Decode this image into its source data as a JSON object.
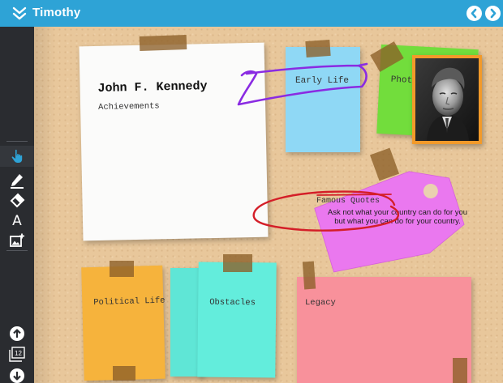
{
  "topbar": {
    "title": "Timothy",
    "bar_color": "#2ea3d6",
    "collapse_icon": "double-chevron-down",
    "prev_icon": "chevron-left-circle",
    "next_icon": "chevron-right-circle"
  },
  "sidebar": {
    "tools": [
      {
        "name": "hand-tool",
        "icon": "hand-pointer",
        "active": true
      },
      {
        "name": "pen-tool",
        "icon": "pencil"
      },
      {
        "name": "eraser-tool",
        "icon": "eraser"
      },
      {
        "name": "text-tool",
        "icon": "letter-a",
        "glyph": "A"
      },
      {
        "name": "add-image-tool",
        "icon": "image-plus"
      }
    ],
    "bottom": {
      "up_icon": "arrow-up-circle",
      "page_number": "12",
      "down_icon": "arrow-down-circle"
    }
  },
  "board": {
    "main_card": {
      "title": "John F. Kennedy",
      "subtitle": "Achievements"
    },
    "notes": {
      "early_life": "Early Life",
      "photo": "Photo",
      "political_life": "Political Life",
      "obstacles": "Obstacles",
      "legacy": "Legacy"
    },
    "quotes_tag": {
      "title": "Famous Quotes",
      "line1": "Ask not what your country can do for you",
      "line2": "but what you can do for your country."
    },
    "colors": {
      "sticky_blue": "#8fd8f5",
      "sticky_green": "#72dd3c",
      "tag_magenta": "#ea78ef",
      "sticky_orange": "#f6b33c",
      "sticky_mint": "#63eddc",
      "sticky_pink": "#f8919b",
      "annotation_purple": "#8a2be2",
      "annotation_red": "#d41e28",
      "cork": "#e8c79b"
    }
  }
}
